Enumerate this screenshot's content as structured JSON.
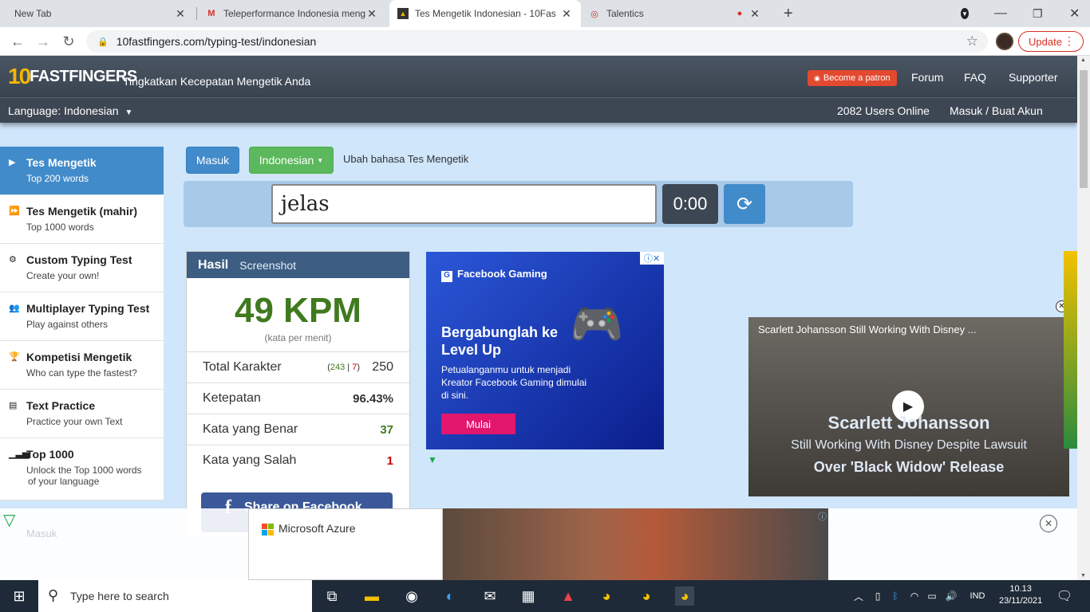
{
  "browser": {
    "tabs": [
      {
        "title": "New Tab"
      },
      {
        "title": "Teleperformance Indonesia meng"
      },
      {
        "title": "Tes Mengetik Indonesian - 10Fas"
      },
      {
        "title": "Talentics"
      }
    ],
    "url": "10fastfingers.com/typing-test/indonesian",
    "update_label": "Update"
  },
  "site": {
    "logo_ten": "10",
    "logo_name": "FASTFINGERS",
    "tagline": "Tingkatkan Kecepatan Mengetik Anda",
    "patron": "Become a patron",
    "nav": [
      "Forum",
      "FAQ",
      "Supporter"
    ],
    "language": "Language: Indonesian",
    "users_online": "2082 Users Online",
    "login": "Masuk / Buat Akun"
  },
  "sidebar": {
    "items": [
      {
        "title": "Tes Mengetik",
        "sub": "Top 200 words",
        "icon": "play-icon"
      },
      {
        "title": "Tes Mengetik (mahir)",
        "sub": "Top 1000 words",
        "icon": "fast-forward-icon"
      },
      {
        "title": "Custom Typing Test",
        "sub": "Create your own!",
        "icon": "gears-icon"
      },
      {
        "title": "Multiplayer Typing Test",
        "sub": "Play against others",
        "icon": "users-icon"
      },
      {
        "title": "Kompetisi Mengetik",
        "sub": "Who can type the fastest?",
        "icon": "trophy-icon"
      },
      {
        "title": "Text Practice",
        "sub": "Practice your own Text",
        "icon": "document-icon"
      },
      {
        "title": "Top 1000",
        "sub": "Unlock the Top 1000 words",
        "sub2": "of your language",
        "icon": "bar-chart-icon"
      }
    ],
    "faded": "Masuk"
  },
  "controls": {
    "masuk": "Masuk",
    "language": "Indonesian",
    "change_lang": "Ubah bahasa Tes Mengetik",
    "input_value": "jelas",
    "timer": "0:00"
  },
  "results": {
    "tab1": "Hasil",
    "tab2": "Screenshot",
    "kpm": "49 KPM",
    "kpm_sub": "(kata per menit)",
    "rows": [
      {
        "label": "Total Karakter",
        "detail_correct": "243",
        "detail_wrong": "7",
        "value": "250"
      },
      {
        "label": "Ketepatan",
        "value": "96.43%"
      },
      {
        "label": "Kata yang Benar",
        "value": "37"
      },
      {
        "label": "Kata yang Salah",
        "value": "1"
      }
    ],
    "share": "Share on Facebook"
  },
  "ad": {
    "brand": "Facebook Gaming",
    "headline": "Bergabunglah ke Level Up",
    "body": "Petualanganmu untuk menjadi Kreator Facebook Gaming dimulai di sini.",
    "cta": "Mulai"
  },
  "video": {
    "title": "Scarlett Johansson Still Working With Disney ...",
    "caption1": "Scarlett Johansson",
    "caption2": "Still Working With Disney Despite Lawsuit",
    "caption3": "Over 'Black Widow' Release"
  },
  "banner": {
    "brand": "Microsoft Azure"
  },
  "taskbar": {
    "search_placeholder": "Type here to search",
    "lang": "IND",
    "time": "10.13",
    "date": "23/11/2021"
  },
  "colors": {
    "header": "#3d4753",
    "primary": "#428bca",
    "success": "#5cb85c",
    "kpm_green": "#3f7a1f",
    "page_bg": "#cfe6fb"
  }
}
